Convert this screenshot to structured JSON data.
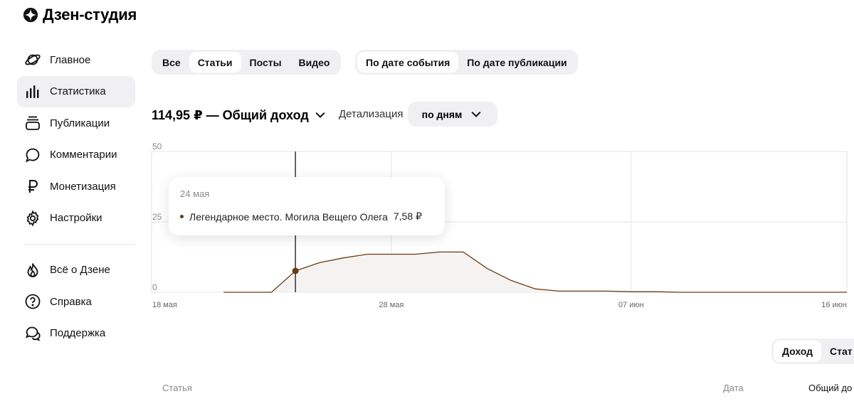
{
  "app": {
    "title": "Дзен-студия"
  },
  "sidebar": {
    "items": [
      {
        "label": "Главное",
        "icon": "planet-icon",
        "active": false
      },
      {
        "label": "Статистика",
        "icon": "bar-chart-icon",
        "active": true
      },
      {
        "label": "Публикации",
        "icon": "stack-icon",
        "active": false
      },
      {
        "label": "Комментарии",
        "icon": "comment-icon",
        "active": false
      },
      {
        "label": "Монетизация",
        "icon": "ruble-icon",
        "active": false
      },
      {
        "label": "Настройки",
        "icon": "gear-icon",
        "active": false
      }
    ],
    "secondary": [
      {
        "label": "Всё о Дзене",
        "icon": "flame-icon"
      },
      {
        "label": "Справка",
        "icon": "question-icon"
      },
      {
        "label": "Поддержка",
        "icon": "support-chat-icon"
      }
    ]
  },
  "filters": {
    "content_types": [
      "Все",
      "Статьи",
      "Посты",
      "Видео"
    ],
    "content_type_selected": "Статьи",
    "date_modes": [
      "По дате события",
      "По дате публикации"
    ],
    "date_mode_selected": "По дате события"
  },
  "summary": {
    "income_title": "114,95 ₽ — Общий доход",
    "detail_label": "Детализация",
    "detail_value": "по дням"
  },
  "tooltip": {
    "date": "24 мая",
    "item": "Легендарное место. Могила Вещего Олега",
    "value": "7,58 ₽"
  },
  "chart_data": {
    "type": "area",
    "y_ticks": [
      "50",
      "25",
      "0"
    ],
    "ylim": [
      0,
      50
    ],
    "x_ticks": [
      "18 мая",
      "28 мая",
      "07 июн",
      "16 июн"
    ],
    "grid": true,
    "series": [
      {
        "color": "#6b3a12",
        "points": [
          [
            "21 мая",
            0
          ],
          [
            "22 мая",
            0
          ],
          [
            "23 мая",
            0
          ],
          [
            "24 мая",
            7.58
          ],
          [
            "25 мая",
            10.5
          ],
          [
            "26 мая",
            12.2
          ],
          [
            "27 мая",
            13.5
          ],
          [
            "28 мая",
            13.5
          ],
          [
            "29 мая",
            13.5
          ],
          [
            "30 мая",
            14.3
          ],
          [
            "31 мая",
            14.3
          ],
          [
            "01 июн",
            8.4
          ],
          [
            "02 июн",
            4.2
          ],
          [
            "03 июн",
            1.2
          ],
          [
            "04 июн",
            0.4
          ],
          [
            "05 июн",
            0.4
          ],
          [
            "06 июн",
            0.4
          ],
          [
            "07 июн",
            0.2
          ],
          [
            "08 июн",
            0.2
          ],
          [
            "09 июн",
            0
          ],
          [
            "16 июн",
            0
          ]
        ]
      }
    ]
  },
  "bottom_tabs": [
    "Доход",
    "Стат"
  ],
  "table": {
    "columns": [
      "Статья",
      "Дата",
      "Общий до"
    ]
  },
  "colors": {
    "accent": "#6b3a12",
    "area_fill": "#f5f3f1",
    "segment_bg": "#f0f0f2"
  }
}
